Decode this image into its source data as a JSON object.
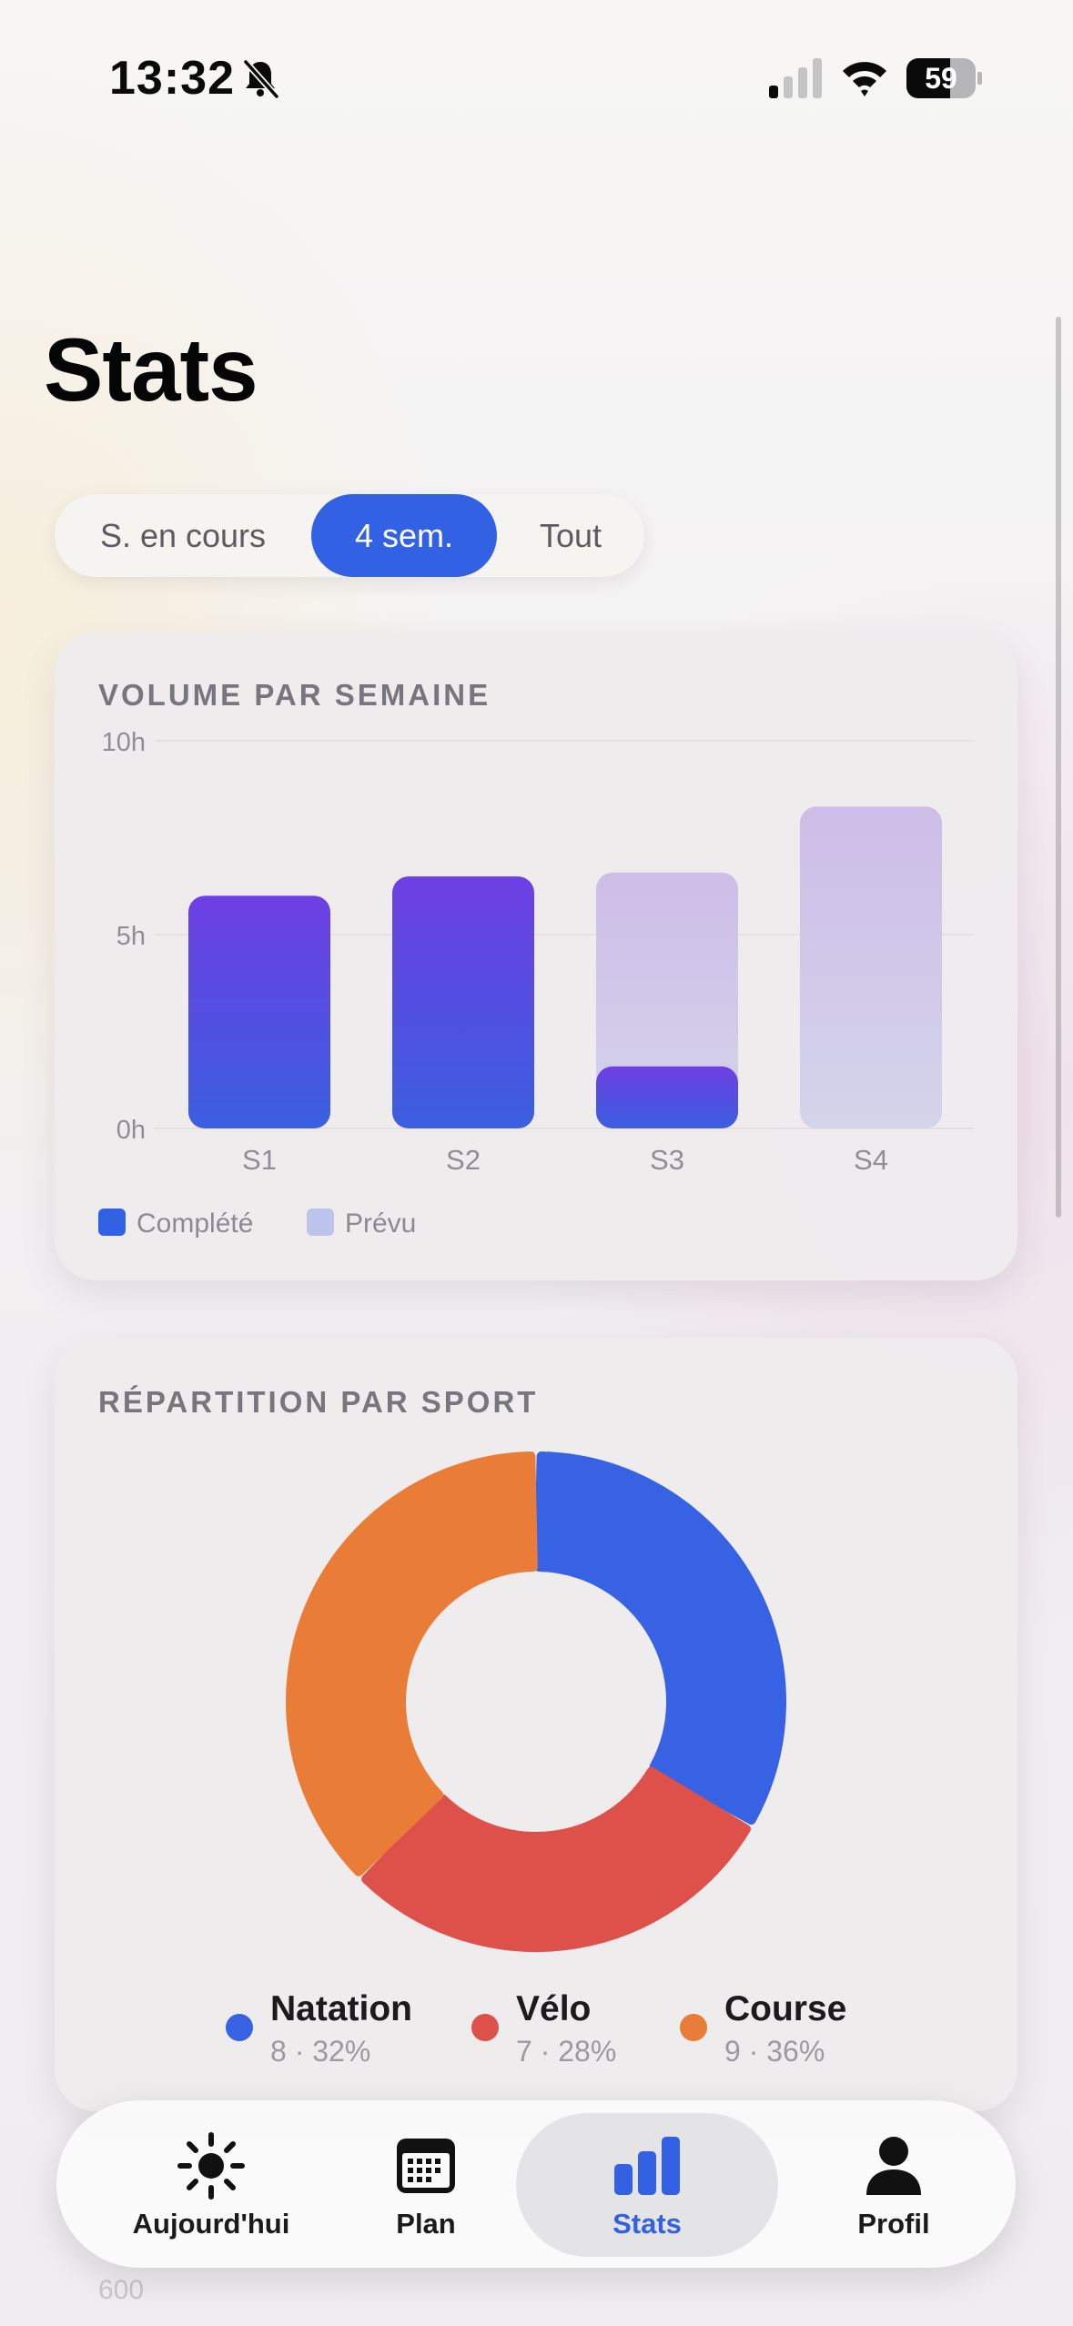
{
  "status_bar": {
    "time": "13:32",
    "battery": "59"
  },
  "page": {
    "title": "Stats"
  },
  "segments": {
    "items": [
      {
        "label": "S. en cours",
        "active": false
      },
      {
        "label": "4 sem.",
        "active": true
      },
      {
        "label": "Tout",
        "active": false
      }
    ]
  },
  "volume_card": {
    "title": "VOLUME PAR SEMAINE",
    "legend": {
      "completed": "Complété",
      "planned": "Prévu"
    }
  },
  "sport_card": {
    "title": "RÉPARTITION PAR SPORT",
    "legend": [
      {
        "name": "Natation",
        "sub": "8 · 32%",
        "color": "#3662e3"
      },
      {
        "name": "Vélo",
        "sub": "7 · 28%",
        "color": "#de514b"
      },
      {
        "name": "Course",
        "sub": "9 · 36%",
        "color": "#e97c37"
      }
    ]
  },
  "next_card_peek": {
    "tick": "600"
  },
  "tabbar": {
    "items": [
      {
        "label": "Aujourd'hui",
        "icon": "sun-icon"
      },
      {
        "label": "Plan",
        "icon": "calendar-icon"
      },
      {
        "label": "Stats",
        "icon": "bar-chart-icon",
        "active": true
      },
      {
        "label": "Profil",
        "icon": "person-icon"
      }
    ]
  },
  "chart_data": [
    {
      "type": "bar",
      "title": "VOLUME PAR SEMAINE",
      "categories": [
        "S1",
        "S2",
        "S3",
        "S4"
      ],
      "y_ticks": [
        "10h",
        "5h",
        "0h"
      ],
      "ylim": [
        0,
        10
      ],
      "series": [
        {
          "name": "Prévu",
          "values": [
            6.0,
            6.5,
            6.6,
            8.3
          ],
          "color": "#cfc1e8"
        },
        {
          "name": "Complété",
          "values": [
            6.0,
            6.5,
            1.6,
            0
          ],
          "color": "#5b4ee0"
        }
      ],
      "grid": true,
      "legend": "bottom-left"
    },
    {
      "type": "pie",
      "title": "RÉPARTITION PAR SPORT",
      "donut": true,
      "slices": [
        {
          "label": "Natation",
          "count": 8,
          "percent": 32,
          "color": "#3662e3"
        },
        {
          "label": "Vélo",
          "count": 7,
          "percent": 28,
          "color": "#de514b"
        },
        {
          "label": "Course",
          "count": 9,
          "percent": 36,
          "color": "#e97c37"
        }
      ]
    }
  ]
}
